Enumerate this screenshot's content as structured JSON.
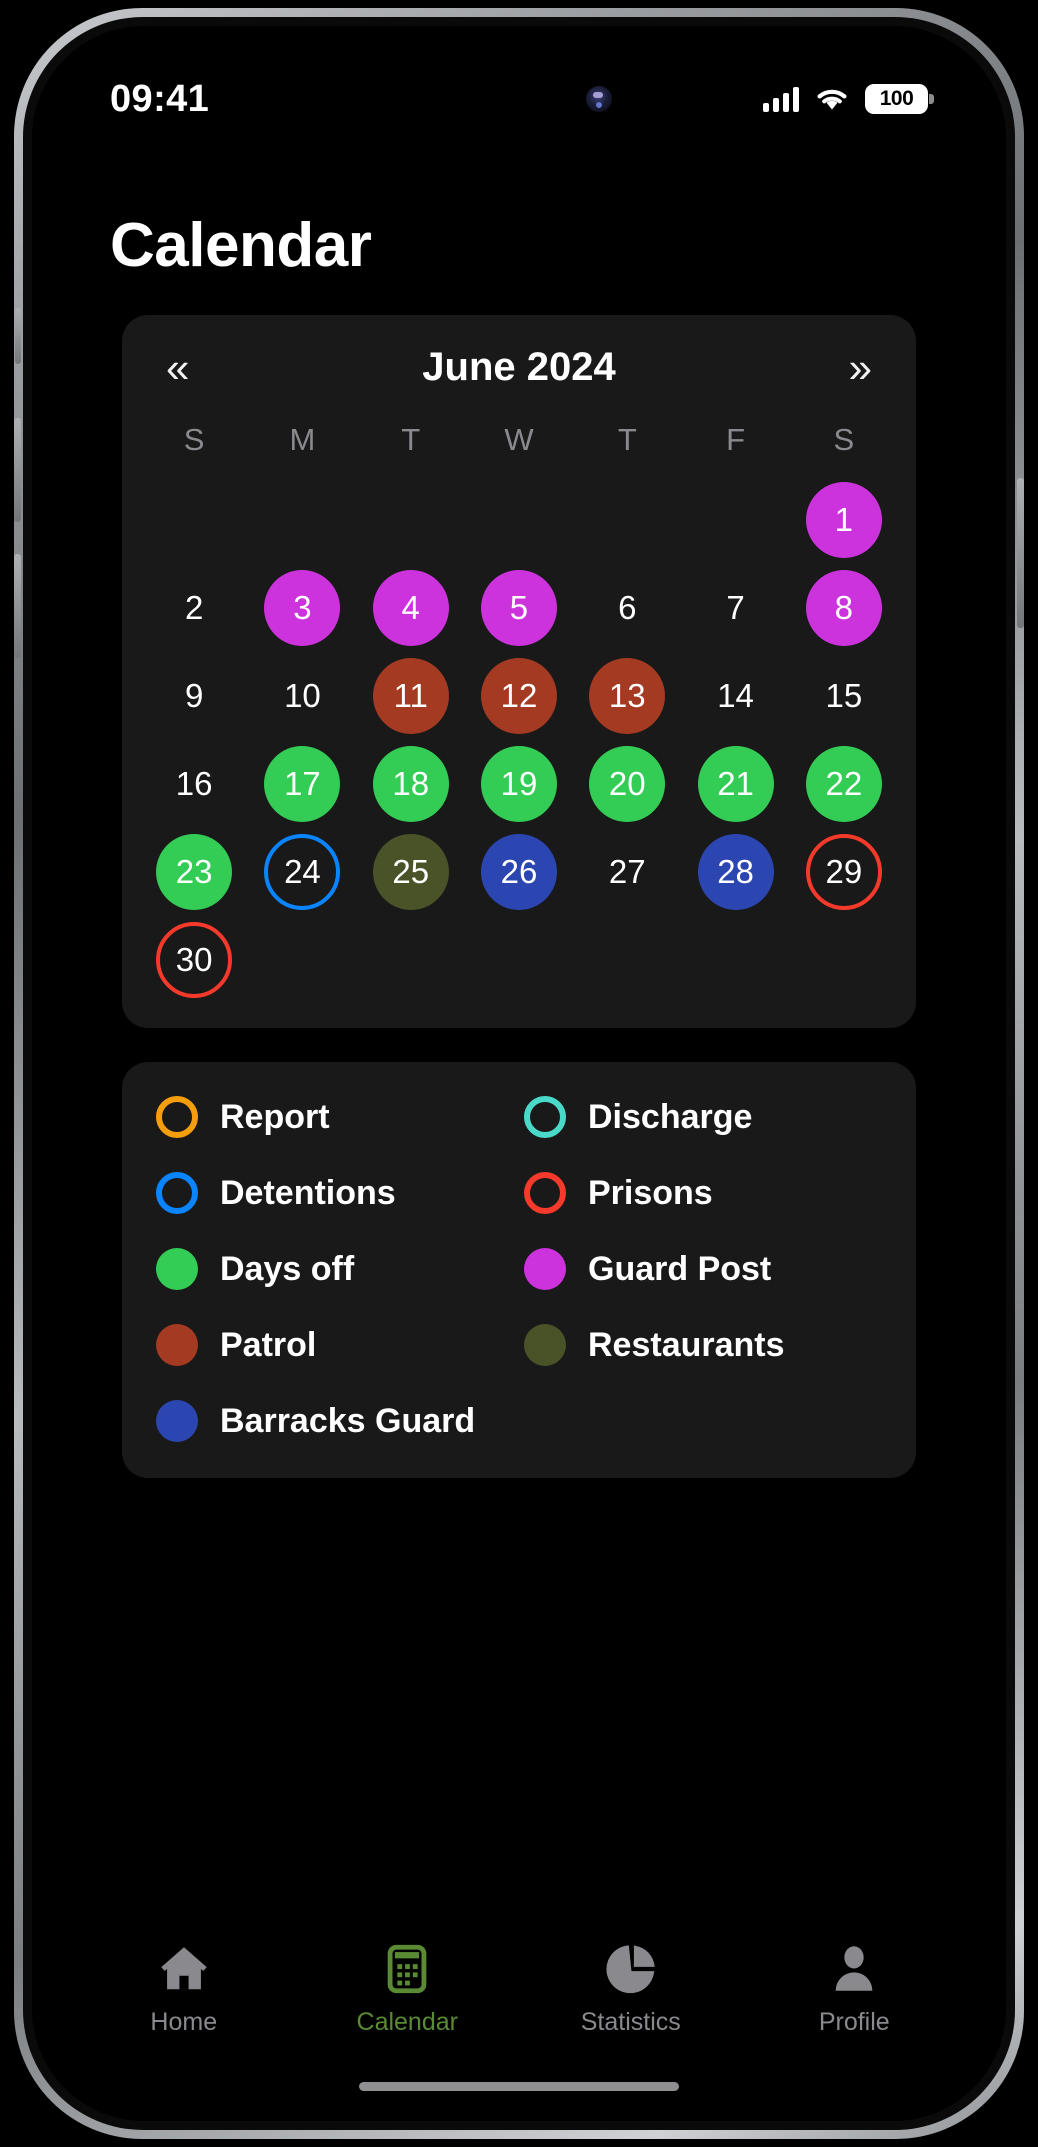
{
  "status_bar": {
    "time": "09:41",
    "battery_level": "100",
    "signal_icon": "cellular-signal-icon",
    "wifi_icon": "wifi-icon",
    "battery_icon": "battery-icon"
  },
  "page_title": "Calendar",
  "calendar": {
    "month_label": "June 2024",
    "prev_icon": "«",
    "next_icon": "»",
    "weekdays": [
      "S",
      "M",
      "T",
      "W",
      "T",
      "F",
      "S"
    ],
    "leading_blanks": 6,
    "days": [
      {
        "n": "1",
        "style": "fill",
        "color": "#cc33dd"
      },
      {
        "n": "2",
        "style": "none",
        "color": ""
      },
      {
        "n": "3",
        "style": "fill",
        "color": "#cc33dd"
      },
      {
        "n": "4",
        "style": "fill",
        "color": "#cc33dd"
      },
      {
        "n": "5",
        "style": "fill",
        "color": "#cc33dd"
      },
      {
        "n": "6",
        "style": "none",
        "color": ""
      },
      {
        "n": "7",
        "style": "none",
        "color": ""
      },
      {
        "n": "8",
        "style": "fill",
        "color": "#cc33dd"
      },
      {
        "n": "9",
        "style": "none",
        "color": ""
      },
      {
        "n": "10",
        "style": "none",
        "color": ""
      },
      {
        "n": "11",
        "style": "fill",
        "color": "#a43a22"
      },
      {
        "n": "12",
        "style": "fill",
        "color": "#a43a22"
      },
      {
        "n": "13",
        "style": "fill",
        "color": "#a43a22"
      },
      {
        "n": "14",
        "style": "none",
        "color": ""
      },
      {
        "n": "15",
        "style": "none",
        "color": ""
      },
      {
        "n": "16",
        "style": "none",
        "color": ""
      },
      {
        "n": "17",
        "style": "fill",
        "color": "#33cc55"
      },
      {
        "n": "18",
        "style": "fill",
        "color": "#33cc55"
      },
      {
        "n": "19",
        "style": "fill",
        "color": "#33cc55"
      },
      {
        "n": "20",
        "style": "fill",
        "color": "#33cc55"
      },
      {
        "n": "21",
        "style": "fill",
        "color": "#33cc55"
      },
      {
        "n": "22",
        "style": "fill",
        "color": "#33cc55"
      },
      {
        "n": "23",
        "style": "fill",
        "color": "#33cc55"
      },
      {
        "n": "24",
        "style": "ring",
        "color": "#0a84ff"
      },
      {
        "n": "25",
        "style": "fill",
        "color": "#4a5228"
      },
      {
        "n": "26",
        "style": "fill",
        "color": "#2b46b0"
      },
      {
        "n": "27",
        "style": "none",
        "color": ""
      },
      {
        "n": "28",
        "style": "fill",
        "color": "#2b46b0"
      },
      {
        "n": "29",
        "style": "ring",
        "color": "#f5392b"
      },
      {
        "n": "30",
        "style": "ring",
        "color": "#f5392b"
      }
    ]
  },
  "legend": {
    "items": [
      {
        "label": "Report",
        "style": "ring",
        "color": "#f59e0b"
      },
      {
        "label": "Discharge",
        "style": "ring",
        "color": "#4ad9c8"
      },
      {
        "label": "Detentions",
        "style": "ring",
        "color": "#0a84ff"
      },
      {
        "label": "Prisons",
        "style": "ring",
        "color": "#f5392b"
      },
      {
        "label": "Days off",
        "style": "fill",
        "color": "#33cc55"
      },
      {
        "label": "Guard Post",
        "style": "fill",
        "color": "#cc33dd"
      },
      {
        "label": "Patrol",
        "style": "fill",
        "color": "#a43a22"
      },
      {
        "label": "Restaurants",
        "style": "fill",
        "color": "#4a5228"
      },
      {
        "label": "Barracks Guard",
        "style": "fill",
        "color": "#2b46b0"
      }
    ]
  },
  "tab_bar": {
    "active_color": "#5a8a33",
    "inactive_color": "#8a8a8e",
    "items": [
      {
        "label": "Home",
        "icon": "home-icon",
        "active": false
      },
      {
        "label": "Calendar",
        "icon": "calendar-icon",
        "active": true
      },
      {
        "label": "Statistics",
        "icon": "pie-chart-icon",
        "active": false
      },
      {
        "label": "Profile",
        "icon": "person-icon",
        "active": false
      }
    ]
  }
}
